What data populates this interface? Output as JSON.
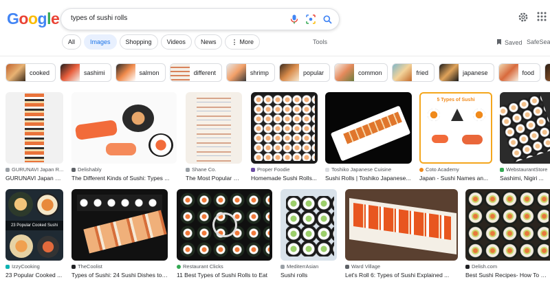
{
  "logo": {
    "letters": [
      "G",
      "o",
      "o",
      "g",
      "l",
      "e"
    ],
    "colors": [
      "#4285f4",
      "#ea4335",
      "#fbbc05",
      "#4285f4",
      "#34a853",
      "#ea4335"
    ]
  },
  "search": {
    "query": "types of sushi rolls"
  },
  "colors": {
    "accent": "#1a73e8"
  },
  "tabs": [
    {
      "label": "All"
    },
    {
      "label": "Images",
      "active": true
    },
    {
      "label": "Shopping"
    },
    {
      "label": "Videos"
    },
    {
      "label": "News"
    },
    {
      "label": "More"
    }
  ],
  "tools_label": "Tools",
  "saved_label": "Saved",
  "safesearch_label": "SafeSear",
  "chips": [
    {
      "label": "cooked"
    },
    {
      "label": "sashimi"
    },
    {
      "label": "salmon"
    },
    {
      "label": "different"
    },
    {
      "label": "shrimp"
    },
    {
      "label": "popular"
    },
    {
      "label": "common"
    },
    {
      "label": "fried"
    },
    {
      "label": "japanese"
    },
    {
      "label": "food"
    }
  ],
  "row1": [
    {
      "source": "GURUNAVI Japan R...",
      "title": "GURUNAVI Japan R..."
    },
    {
      "source": "Delishably",
      "title": "The Different Kinds of Sushi: Types ..."
    },
    {
      "source": "Shane Co.",
      "title": "The Most Popular S..."
    },
    {
      "source": "Proper Foodie",
      "title": "Homemade Sushi Rolls..."
    },
    {
      "source": "Toshiko Japanese Cuisine",
      "title": "Sushi Rolls | Toshiko Japanese..."
    },
    {
      "source": "Coto Academy",
      "title": "Japan - Sushi Names an..."
    },
    {
      "source": "WebstaurantStore",
      "title": "Sashimi, Nigiri ..."
    }
  ],
  "row2": [
    {
      "source": "IzzyCooking",
      "title": "23 Popular Cooked ..."
    },
    {
      "source": "TheCoolist",
      "title": "Types of Sushi: 24 Sushi Dishes to ..."
    },
    {
      "source": "Restaurant Clicks",
      "title": "11 Best Types of Sushi Rolls to Eat"
    },
    {
      "source": "MediterrAsian",
      "title": "Sushi rolls"
    },
    {
      "source": "Ward Village",
      "title": "Let's Roll 6: Types of Sushi Explained ..."
    },
    {
      "source": "Delish.com",
      "title": "Best Sushi Recipes- How To Mak..."
    }
  ],
  "overlays": {
    "cooked_title": "23 Popular Cooked Sushi",
    "coto_heading": "5 Types of Sushi"
  }
}
